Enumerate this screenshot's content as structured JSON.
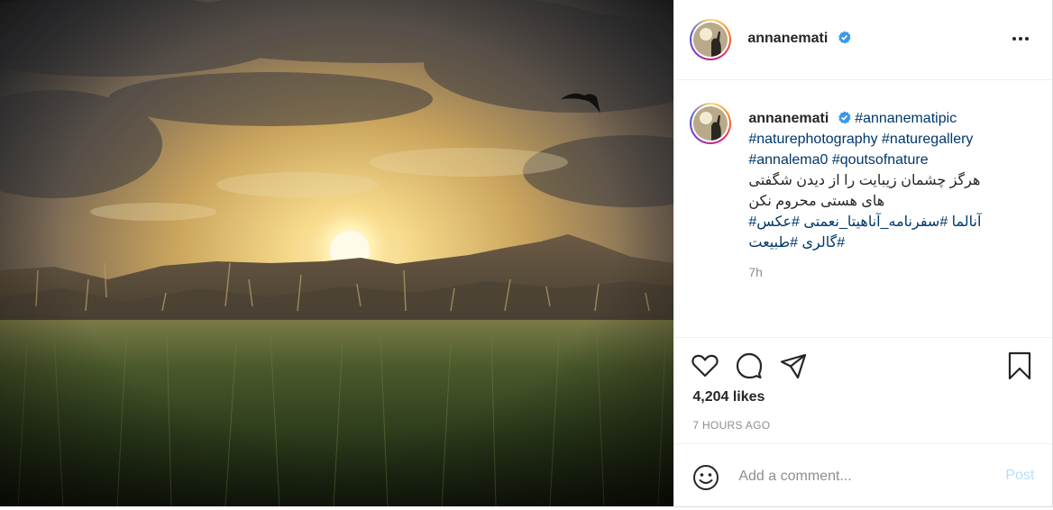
{
  "post": {
    "username": "annanemati",
    "verified": true,
    "caption": {
      "hashtag_line1": "#annanematipic",
      "hashtag_line2": "#naturephotography #naturegallery",
      "hashtag_line3": "#annalema0 #qoutsofnature",
      "persian_line1": "هرگز چشمان زیبایت را از دیدن شگفتی",
      "persian_line2": "های هستی محروم نکن",
      "persian_line3": "آنالما #سفرنامه_آناهیتا_نعمتی #عکس#",
      "persian_line4": "#گالری #طبیعت"
    },
    "caption_time": "7h",
    "likes": "4,204 likes",
    "posted_ago": "7 HOURS AGO",
    "comment_placeholder": "Add a comment...",
    "post_label": "Post"
  },
  "colors": {
    "verified_badge": "#3897f0",
    "link": "#00376b",
    "post_button_disabled": "#b2dffc",
    "muted": "#8e8e8e"
  },
  "icons": [
    "more-options-icon",
    "heart-icon",
    "comment-icon",
    "share-icon",
    "bookmark-icon",
    "emoji-icon",
    "verified-icon"
  ]
}
